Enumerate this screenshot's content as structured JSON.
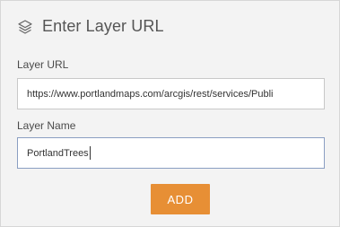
{
  "dialog": {
    "title": "Enter Layer URL",
    "header_icon": "layers-icon"
  },
  "layer_url": {
    "label": "Layer URL",
    "value": "https://www.portlandmaps.com/arcgis/rest/services/Publi"
  },
  "layer_name": {
    "label": "Layer Name",
    "value": "PortlandTrees"
  },
  "actions": {
    "add_label": "ADD"
  },
  "colors": {
    "panel_background": "#f3f3f3",
    "accent_button": "#e78f35",
    "focused_border": "#8a9ec2"
  }
}
